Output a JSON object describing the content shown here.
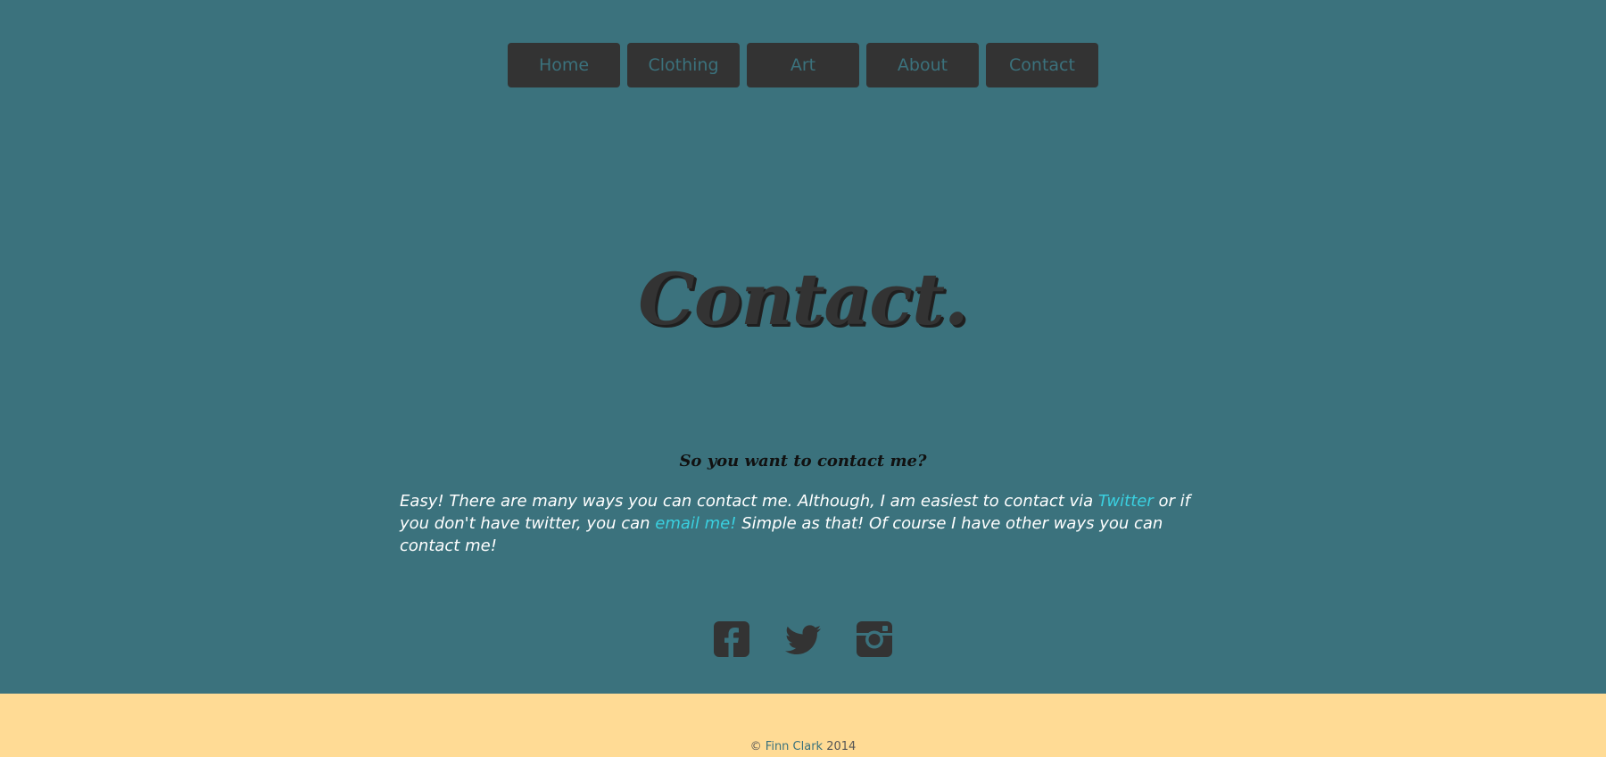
{
  "nav": {
    "items": [
      {
        "label": "Home"
      },
      {
        "label": "Clothing"
      },
      {
        "label": "Art"
      },
      {
        "label": "About"
      },
      {
        "label": "Contact"
      }
    ]
  },
  "hero": {
    "title": "Contact."
  },
  "content": {
    "subheading": "So you want to contact me?",
    "text_part1": "Easy! There are many ways you can contact me. Although, I am easiest to contact via ",
    "twitter_link": "Twitter",
    "text_part2": " or if you don't have twitter, you can ",
    "email_link": "email me!",
    "text_part3": " Simple as that! Of course I have other ways you can contact me!"
  },
  "social": {
    "icons": [
      "facebook-icon",
      "twitter-icon",
      "instagram-icon"
    ]
  },
  "footer": {
    "copyright_symbol": "©",
    "author_link": "Finn Clark",
    "year": "2014"
  },
  "colors": {
    "background": "#3b727d",
    "nav_button": "#333333",
    "link": "#3ad0e0",
    "footer_bg": "#ffdb95"
  }
}
